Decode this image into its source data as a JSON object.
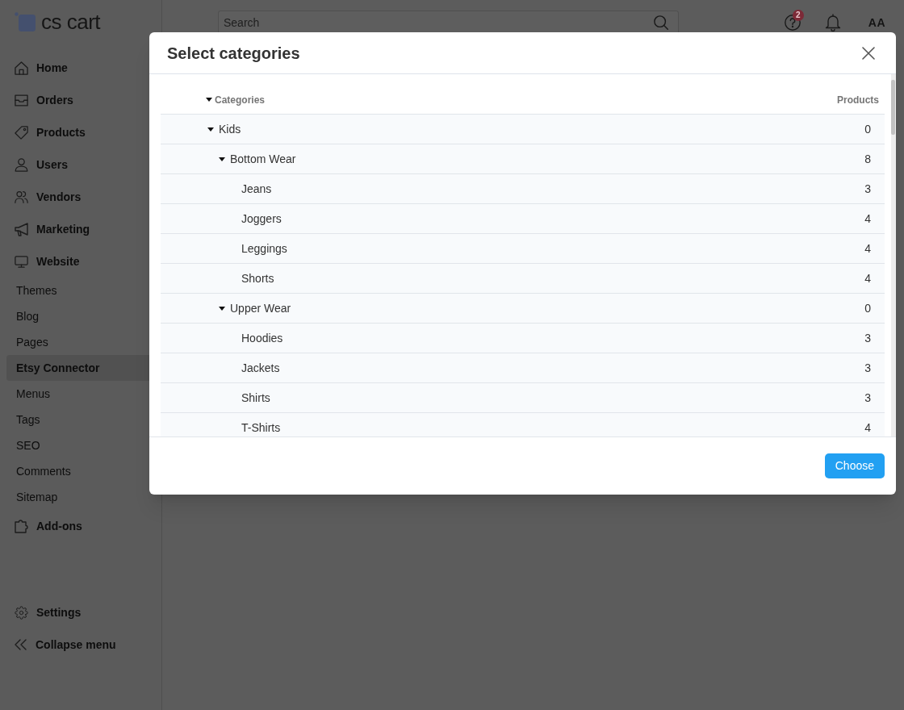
{
  "sidebar": {
    "logo": "cs cart",
    "items": [
      {
        "label": "Home",
        "selected": false
      },
      {
        "label": "Orders",
        "selected": false
      },
      {
        "label": "Products",
        "selected": false
      },
      {
        "label": "Users",
        "selected": false
      },
      {
        "label": "Vendors",
        "selected": false
      },
      {
        "label": "Marketing",
        "selected": false
      },
      {
        "label": "Website",
        "selected": false,
        "children": [
          {
            "label": "Themes",
            "selected": false
          },
          {
            "label": "Blog",
            "selected": false
          },
          {
            "label": "Pages",
            "selected": false
          },
          {
            "label": "Etsy Connector",
            "selected": true
          },
          {
            "label": "Menus",
            "selected": false
          },
          {
            "label": "Tags",
            "selected": false
          },
          {
            "label": "SEO",
            "selected": false
          },
          {
            "label": "Comments",
            "selected": false
          },
          {
            "label": "Sitemap",
            "selected": false
          }
        ]
      },
      {
        "label": "Add-ons",
        "selected": false
      }
    ],
    "bottom_items": [
      {
        "label": "Settings"
      },
      {
        "label": "Collapse menu"
      }
    ]
  },
  "topbar": {
    "search_placeholder": "Search",
    "notification_count": "2",
    "avatar_initials": "AA"
  },
  "dialog": {
    "title": "Select categories",
    "header": {
      "categories_label": "Categories",
      "expanded": true,
      "products_label": "Products"
    },
    "tree": [
      {
        "name": "Kids",
        "products": "0",
        "expanded": true,
        "children": [
          {
            "name": "Bottom Wear",
            "products": "8",
            "expanded": true,
            "children": [
              {
                "name": "Jeans",
                "products": "3"
              },
              {
                "name": "Joggers",
                "products": "4"
              },
              {
                "name": "Leggings",
                "products": "4"
              },
              {
                "name": "Shorts",
                "products": "4"
              }
            ]
          },
          {
            "name": "Upper Wear",
            "products": "0",
            "expanded": true,
            "children": [
              {
                "name": "Hoodies",
                "products": "3"
              },
              {
                "name": "Jackets",
                "products": "3"
              },
              {
                "name": "Shirts",
                "products": "3"
              },
              {
                "name": "T-Shirts",
                "products": "4"
              }
            ]
          }
        ]
      }
    ],
    "choose_button": "Choose"
  }
}
